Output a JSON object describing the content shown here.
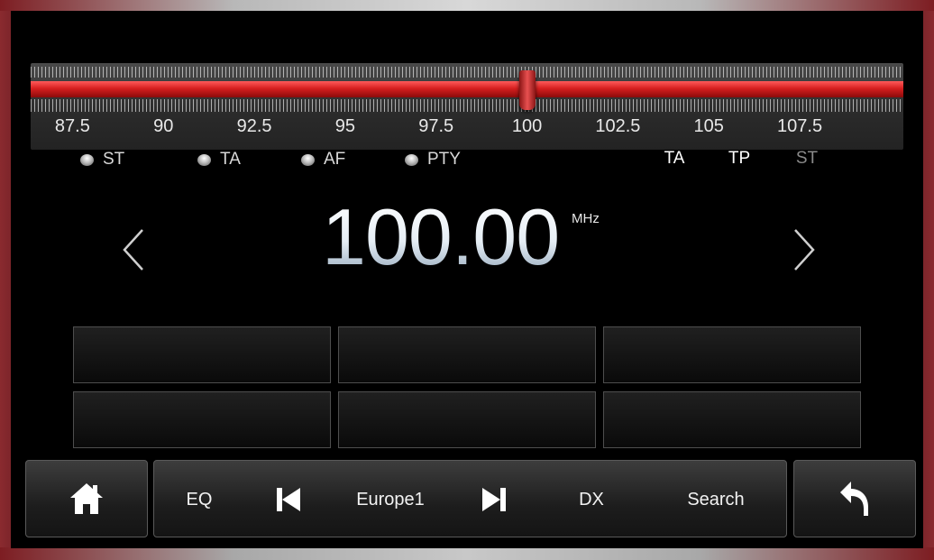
{
  "tuner": {
    "scale_labels": [
      "87.5",
      "90",
      "92.5",
      "95",
      "97.5",
      "100",
      "102.5",
      "105",
      "107.5"
    ],
    "needle_position_mhz": 100.0,
    "range_mhz": [
      86.35,
      110.35
    ]
  },
  "indicators": [
    {
      "label": "ST"
    },
    {
      "label": "TA"
    },
    {
      "label": "AF"
    },
    {
      "label": "PTY"
    }
  ],
  "status": {
    "ta": "TA",
    "tp": "TP",
    "st": "ST"
  },
  "frequency": {
    "value": "100.00",
    "unit": "MHz"
  },
  "presets": [
    "",
    "",
    "",
    "",
    "",
    ""
  ],
  "bottom_bar": {
    "eq": "EQ",
    "station": "Europe1",
    "dx": "DX",
    "search": "Search"
  },
  "icons": {
    "home": "home-icon",
    "prev": "skip-previous-icon",
    "next": "skip-next-icon",
    "back": "back-arrow-icon",
    "left": "chevron-left-icon",
    "right": "chevron-right-icon"
  },
  "colors": {
    "accent_red": "#d71f1f",
    "text": "#e6e6e6",
    "status_active": "#ffffff",
    "status_inactive": "#8a8a8a"
  }
}
